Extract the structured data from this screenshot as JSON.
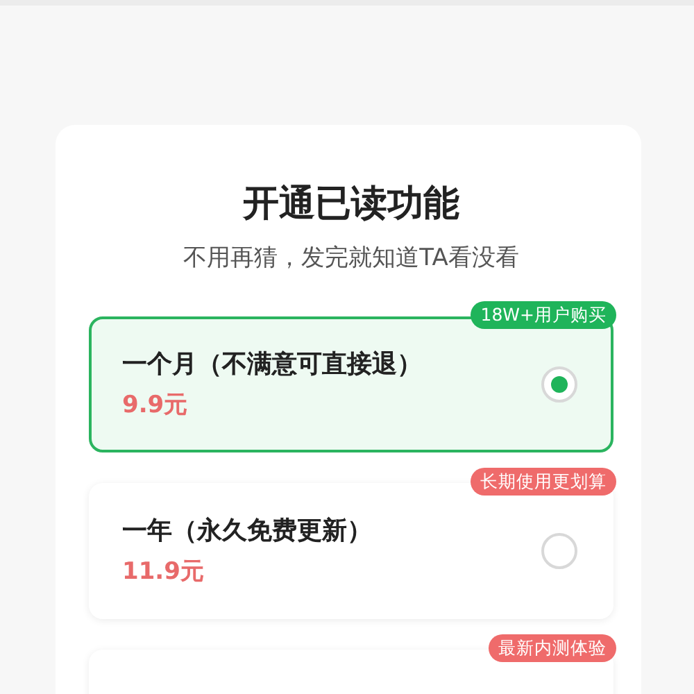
{
  "title": "开通已读功能",
  "subtitle": "不用再猜，发完就知道TA看没看",
  "plans": [
    {
      "badge": "18W+用户购买",
      "color": "#1fb45a",
      "name": "一个月（不满意可直接退）",
      "price": "9.9元",
      "selected": true
    },
    {
      "badge": "长期使用更划算",
      "color": "#ef6b6b",
      "name": "一年（永久免费更新）",
      "price": "11.9元",
      "selected": false
    },
    {
      "badge": "最新内测体验",
      "color": "#ef6b6b",
      "selected": false
    }
  ]
}
